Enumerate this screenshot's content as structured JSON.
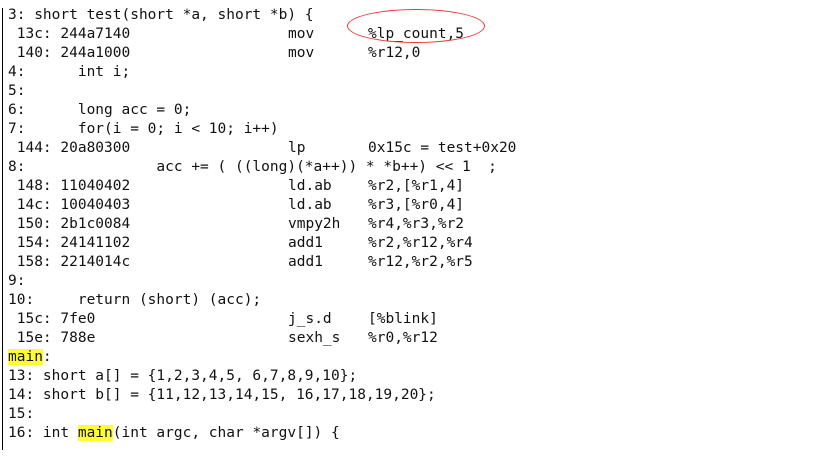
{
  "listing": {
    "lines": [
      {
        "kind": "src",
        "text": "3: short test(short *a, short *b) {"
      },
      {
        "kind": "asm",
        "addr": " 13c: 244a7140",
        "mnem": "mov",
        "ops": "%lp_count,5"
      },
      {
        "kind": "asm",
        "addr": " 140: 244a1000",
        "mnem": "mov",
        "ops": "%r12,0"
      },
      {
        "kind": "src",
        "text": "4:      int i;"
      },
      {
        "kind": "src",
        "text": "5:"
      },
      {
        "kind": "src",
        "text": "6:      long acc = 0;"
      },
      {
        "kind": "src",
        "text": "7:      for(i = 0; i < 10; i++)"
      },
      {
        "kind": "asm",
        "addr": " 144: 20a80300",
        "mnem": "lp",
        "ops": "0x15c = test+0x20"
      },
      {
        "kind": "src",
        "text": "8:               acc += ( ((long)(*a++)) * *b++) << 1  ;"
      },
      {
        "kind": "asm",
        "addr": " 148: 11040402",
        "mnem": "ld.ab",
        "ops": "%r2,[%r1,4]"
      },
      {
        "kind": "asm",
        "addr": " 14c: 10040403",
        "mnem": "ld.ab",
        "ops": "%r3,[%r0,4]"
      },
      {
        "kind": "asm",
        "addr": " 150: 2b1c0084",
        "mnem": "vmpy2h",
        "ops": "%r4,%r3,%r2"
      },
      {
        "kind": "asm",
        "addr": " 154: 24141102",
        "mnem": "add1",
        "ops": "%r2,%r12,%r4"
      },
      {
        "kind": "asm",
        "addr": " 158: 2214014c",
        "mnem": "add1",
        "ops": "%r12,%r2,%r5"
      },
      {
        "kind": "src",
        "text": "9:"
      },
      {
        "kind": "src",
        "text": "10:     return (short) (acc);"
      },
      {
        "kind": "asm",
        "addr": " 15c: 7fe0",
        "mnem": "j_s.d",
        "ops": "[%blink]"
      },
      {
        "kind": "asm",
        "addr": " 15e: 788e",
        "mnem": "sexh_s",
        "ops": "%r0,%r12"
      },
      {
        "kind": "label",
        "hl": "main",
        "rest": ":"
      },
      {
        "kind": "src",
        "text": "13: short a[] = {1,2,3,4,5, 6,7,8,9,10};"
      },
      {
        "kind": "src",
        "text": "14: short b[] = {11,12,13,14,15, 16,17,18,19,20};"
      },
      {
        "kind": "src",
        "text": "15:"
      },
      {
        "kind": "srchl",
        "pre": "16: int ",
        "hl": "main",
        "post": "(int argc, char *argv[]) {"
      }
    ]
  },
  "colors": {
    "highlight": "#ffff33",
    "callout": "#e63a3a",
    "text": "#111111"
  }
}
